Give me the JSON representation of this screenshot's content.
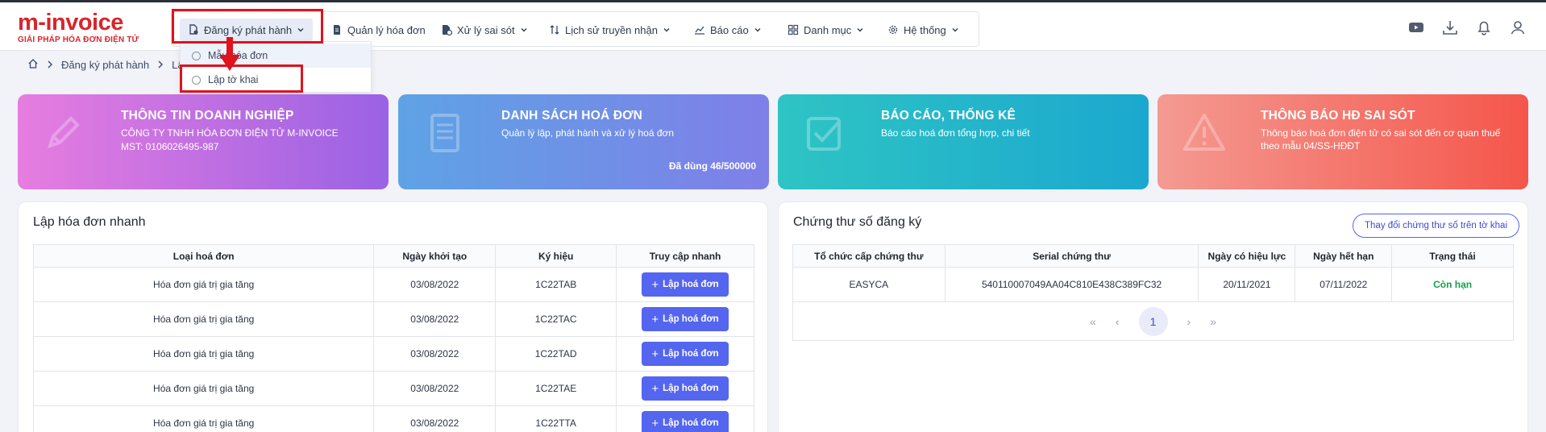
{
  "logo": {
    "main": "m-invoice",
    "sub": "GIẢI PHÁP HÓA ĐƠN ĐIỆN TỬ"
  },
  "nav": {
    "items": [
      {
        "label": "Đăng ký phát hành",
        "icon": "file-register-icon"
      },
      {
        "label": "Quản lý hóa đơn",
        "icon": "invoice-icon"
      },
      {
        "label": "Xử lý sai sót",
        "icon": "file-error-icon"
      },
      {
        "label": "Lịch sử truyền nhận",
        "icon": "sort-arrows-icon"
      },
      {
        "label": "Báo cáo",
        "icon": "chart-icon"
      },
      {
        "label": "Danh mục",
        "icon": "grid-icon"
      },
      {
        "label": "Hệ thống",
        "icon": "gear-icon"
      }
    ]
  },
  "dropdown": {
    "items": [
      {
        "label": "Mẫu hóa đơn"
      },
      {
        "label": "Lập tờ khai"
      }
    ]
  },
  "breadcrumb": {
    "item1": "Đăng ký phát hành",
    "item2": "Lập"
  },
  "cards": [
    {
      "title": "THÔNG TIN DOANH NGHIỆP",
      "line1": "CÔNG TY TNHH HÓA ĐƠN ĐIỆN TỬ M-INVOICE",
      "line2": "MST: 0106026495-987",
      "footer": "",
      "icon": "pencil-icon"
    },
    {
      "title": "DANH SÁCH HOÁ ĐƠN",
      "line1": "Quản lý lập, phát hành và xử lý hoá đơn",
      "line2": "",
      "footer": "Đã dùng 46/500000",
      "icon": "document-icon"
    },
    {
      "title": "BÁO CÁO, THỐNG KÊ",
      "line1": "Báo cáo hoá đơn tổng hợp, chi tiết",
      "line2": "",
      "footer": "",
      "icon": "checkbox-icon"
    },
    {
      "title": "THÔNG BÁO HĐ SAI SÓT",
      "line1": "Thông báo hoá đơn điện tử có sai sót đến cơ quan thuế",
      "line2": "theo mẫu 04/SS-HĐĐT",
      "footer": "",
      "icon": "warning-icon"
    }
  ],
  "quick": {
    "title": "Lập hóa đơn nhanh",
    "headers": [
      "Loại hoá đơn",
      "Ngày khởi tạo",
      "Ký hiệu",
      "Truy cập nhanh"
    ],
    "button_label": "Lập hoá đơn",
    "rows": [
      {
        "type": "Hóa đơn giá trị gia tăng",
        "date": "03/08/2022",
        "code": "1C22TAB"
      },
      {
        "type": "Hóa đơn giá trị gia tăng",
        "date": "03/08/2022",
        "code": "1C22TAC"
      },
      {
        "type": "Hóa đơn giá trị gia tăng",
        "date": "03/08/2022",
        "code": "1C22TAD"
      },
      {
        "type": "Hóa đơn giá trị gia tăng",
        "date": "03/08/2022",
        "code": "1C22TAE"
      },
      {
        "type": "Hóa đơn giá trị gia tăng",
        "date": "03/08/2022",
        "code": "1C22TTA"
      }
    ]
  },
  "cert": {
    "title": "Chứng thư số đăng ký",
    "change_button": "Thay đổi chứng thư số trên tờ khai",
    "headers": [
      "Tổ chức cấp chứng thư",
      "Serial chứng thư",
      "Ngày có hiệu lực",
      "Ngày hết hạn",
      "Trạng thái"
    ],
    "rows": [
      {
        "issuer": "EASYCA",
        "serial": "540110007049AA04C810E438C389FC32",
        "from": "20/11/2021",
        "to": "07/11/2022",
        "status": "Còn hạn"
      }
    ],
    "pager": {
      "first": "«",
      "prev": "‹",
      "current": "1",
      "next": "›",
      "last": "»"
    }
  },
  "colors": {
    "brand": "#d7262c",
    "accent": "#5465f0",
    "highlight": "#e0121c",
    "status_ok": "#17a04a"
  }
}
